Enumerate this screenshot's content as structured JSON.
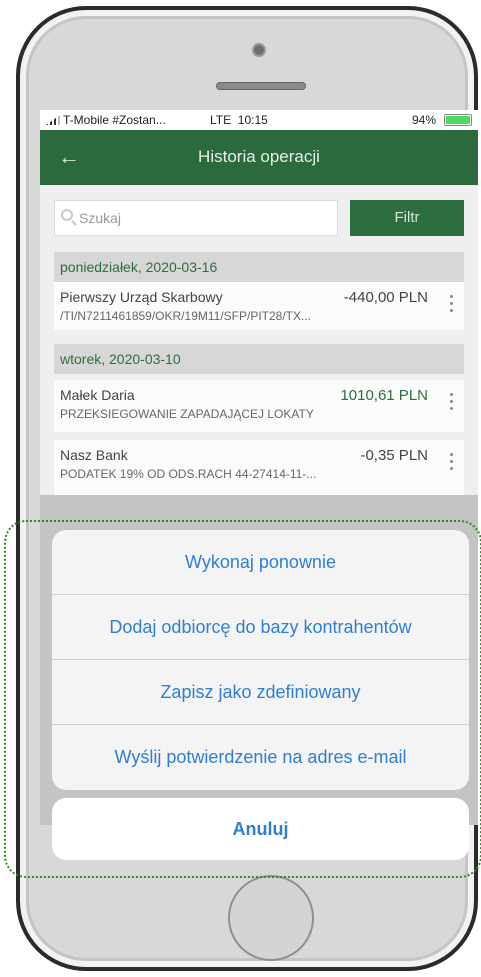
{
  "statusbar": {
    "carrier": "T-Mobile #Zostan...",
    "network": "LTE",
    "time": "10:15",
    "battery": "94%",
    "battery_level": 0.94
  },
  "navbar": {
    "title": "Historia operacji",
    "back_icon": "arrow-left-icon"
  },
  "search": {
    "placeholder": "Szukaj",
    "filter_label": "Filtr"
  },
  "days": [
    {
      "date": "poniedziałek, 2020-03-16",
      "transactions": [
        {
          "name": "Pierwszy Urząd Skarbowy",
          "amount": "-440,00 PLN",
          "description": "/TI/N7211461859/OKR/19M11/SFP/PIT28/TX..."
        }
      ]
    },
    {
      "date": "wtorek, 2020-03-10",
      "transactions": [
        {
          "name": "Małek Daria",
          "amount": "1010,61 PLN",
          "description": "PRZEKSIEGOWANIE ZAPADAJĄCEJ LOKATY"
        },
        {
          "name": "Nasz Bank",
          "amount": "-0,35 PLN",
          "description": "PODATEK 19% OD ODS.RACH 44-27414-11-..."
        }
      ]
    }
  ],
  "action_sheet": {
    "actions": [
      "Wykonaj ponownie",
      "Dodaj odbiorcę do bazy kontrahentów",
      "Zapisz jako zdefiniowany",
      "Wyślij potwierdzenie na adres e-mail"
    ],
    "cancel": "Anuluj"
  },
  "colors": {
    "brand_green": "#2b6a3c",
    "action_blue": "#2f7ed4",
    "highlight_dotted": "#2e8b1e"
  }
}
